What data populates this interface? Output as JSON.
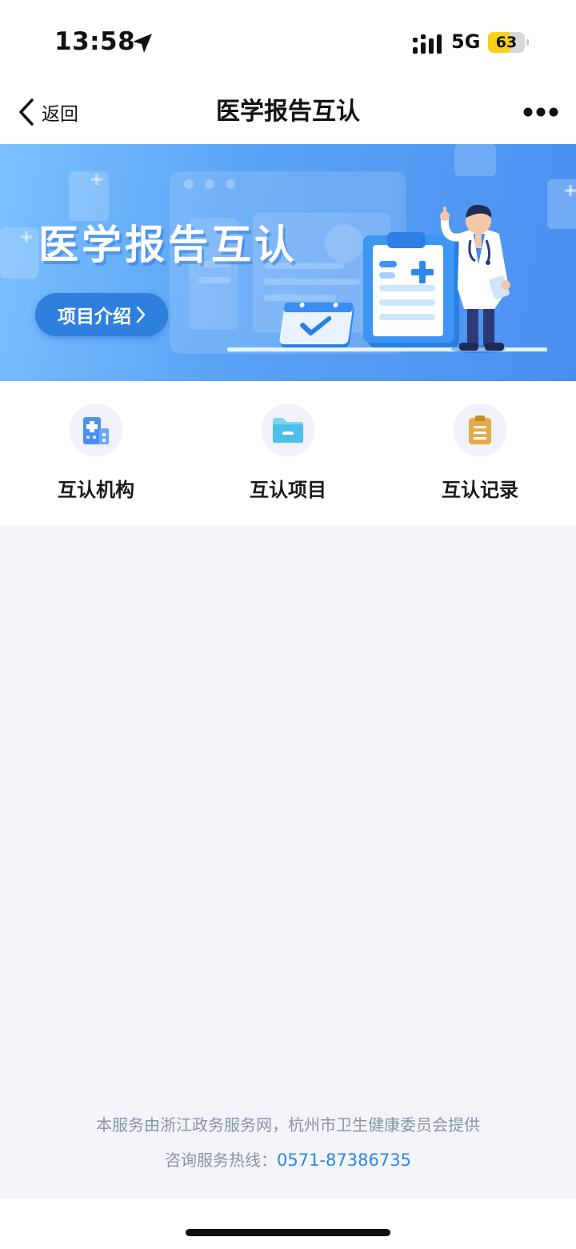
{
  "status_bar": {
    "time": "13:58",
    "network": "5G",
    "battery": "63",
    "battery_level": 0.63,
    "battery_color": "#f9cf1a"
  },
  "nav": {
    "back_label": "返回",
    "title": "医学报告互认",
    "more_icon": "more-horizontal-icon"
  },
  "banner": {
    "title": "医学报告互认",
    "intro_button": "项目介绍"
  },
  "quick_actions": [
    {
      "label": "互认机构",
      "icon": "hospital-building-icon",
      "color": "#4a8ff0"
    },
    {
      "label": "互认项目",
      "icon": "folder-icon",
      "color": "#5cc6ec"
    },
    {
      "label": "互认记录",
      "icon": "clipboard-icon",
      "color": "#e3a94c"
    }
  ],
  "footer": {
    "provider_text": "本服务由浙江政务服务网，杭州市卫生健康委员会提供",
    "hotline_label": "咨询服务热线：",
    "hotline_number": "0571-87386735"
  },
  "colors": {
    "accent": "#2f86e6",
    "page_bg": "#f2f4f8"
  }
}
